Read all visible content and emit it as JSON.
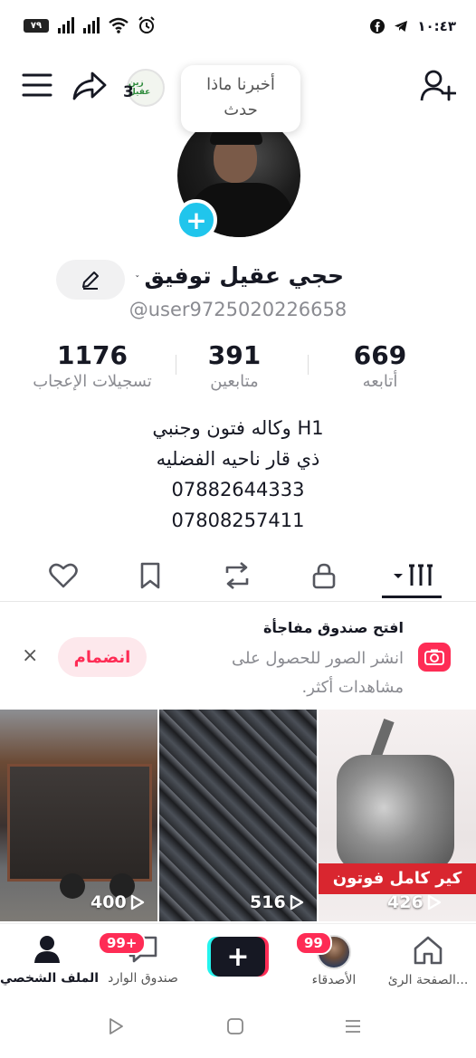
{
  "status_bar": {
    "battery": "٧٩",
    "time": "١٠:٤٣"
  },
  "header": {
    "tooltip_line1": "أخبرنا ماذا",
    "tooltip_line2": "حدث",
    "mini_avatar_count": "3",
    "mini_avatar_label": "زين عقيل"
  },
  "profile": {
    "name": "حجي عقيل توفيق",
    "username": "@user9725020226658",
    "stats": [
      {
        "num": "1176",
        "label": "تسجيلات الإعجاب"
      },
      {
        "num": "391",
        "label": "متابعين"
      },
      {
        "num": "669",
        "label": "أتابعه"
      }
    ],
    "bio": [
      "وكاله فتون وجنبي H1",
      "ذي قار ناحيه الفضليه",
      "07882644333",
      "07808257411"
    ]
  },
  "promo": {
    "title": "افتح صندوق مفاجأة",
    "text": "انشر الصور للحصول على مشاهدات أكثر.",
    "join_label": "انضمام",
    "close_symbol": "×"
  },
  "videos": [
    {
      "views": "400"
    },
    {
      "views": "516"
    },
    {
      "views": "426",
      "banner": "كير كامل فوتون"
    }
  ],
  "bottom_nav": {
    "profile": "الملف الشخصي",
    "inbox": "صندوق الوارد",
    "inbox_badge": "99+",
    "friends": "الأصدقاء",
    "friends_badge": "99",
    "home": "الصفحة الرئ...",
    "create_symbol": "+"
  },
  "colors": {
    "accent": "#fe2c55",
    "cyan": "#25f4ee",
    "avatar_plus": "#20c5ec",
    "text_primary": "#161823",
    "text_secondary": "#8a8b91"
  }
}
